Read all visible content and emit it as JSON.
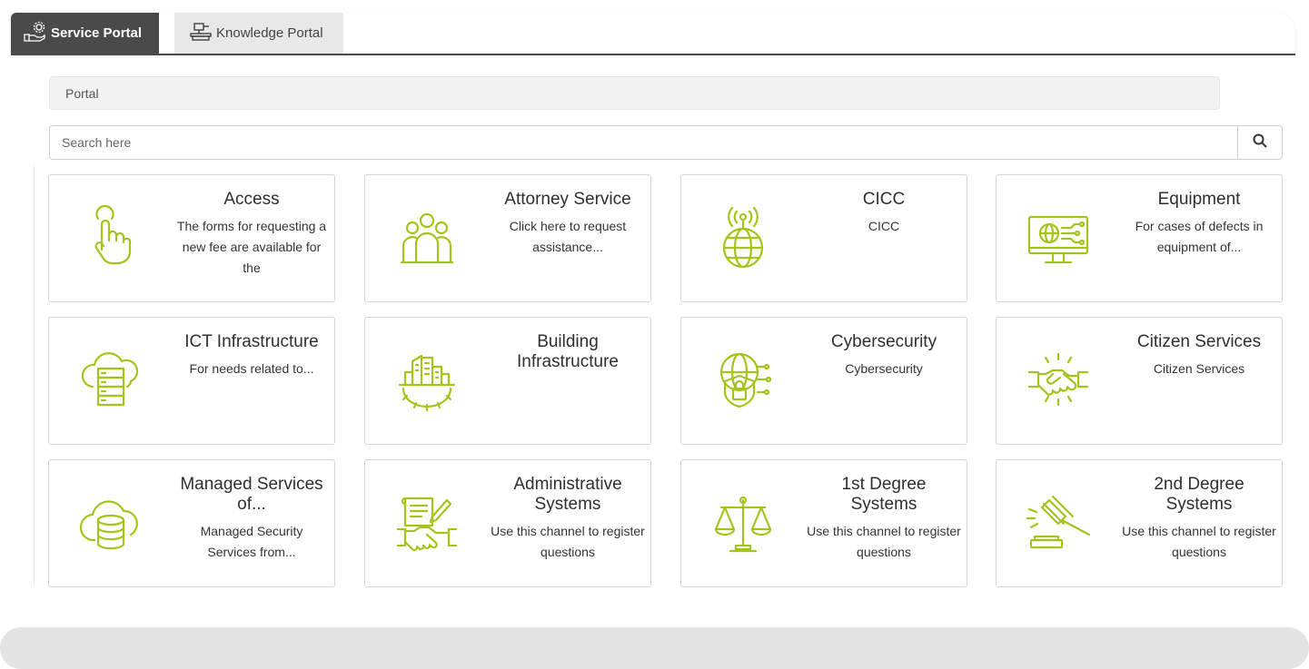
{
  "tabs": [
    {
      "label": "Service Portal",
      "icon": "service-portal-icon",
      "active": true
    },
    {
      "label": "Knowledge Portal",
      "icon": "knowledge-portal-icon",
      "active": false
    }
  ],
  "breadcrumb": "Portal",
  "search": {
    "placeholder": "Search here",
    "icon": "search-icon"
  },
  "accent_color": "#a3c41a",
  "cards": [
    {
      "title": "Access",
      "description": "The forms for requesting a new fee are available for the",
      "icon": "hand-pointer-icon"
    },
    {
      "title": "Attorney Service",
      "description": "Click here to request assistance...",
      "icon": "people-group-icon"
    },
    {
      "title": "CICC",
      "description": "CICC",
      "icon": "globe-antenna-icon"
    },
    {
      "title": "Equipment",
      "description": "For cases of defects in equipment of...",
      "icon": "monitor-network-icon"
    },
    {
      "title": "ICT Infrastructure",
      "description": "For needs related to...",
      "icon": "cloud-server-icon"
    },
    {
      "title": "Building Infrastructure",
      "description": "",
      "icon": "building-gear-icon"
    },
    {
      "title": "Cybersecurity",
      "description": "Cybersecurity",
      "icon": "shield-lock-icon"
    },
    {
      "title": "Citizen Services",
      "description": "Citizen Services",
      "icon": "handshake-icon"
    },
    {
      "title": "Managed Services of...",
      "description": "Managed Security Services from...",
      "icon": "cloud-database-icon"
    },
    {
      "title": "Administrative Systems",
      "description": "Use this channel to register questions",
      "icon": "contract-handshake-icon"
    },
    {
      "title": "1st Degree Systems",
      "description": "Use this channel to register questions",
      "icon": "scales-icon"
    },
    {
      "title": "2nd Degree Systems",
      "description": "Use this channel to register questions",
      "icon": "gavel-icon"
    }
  ]
}
